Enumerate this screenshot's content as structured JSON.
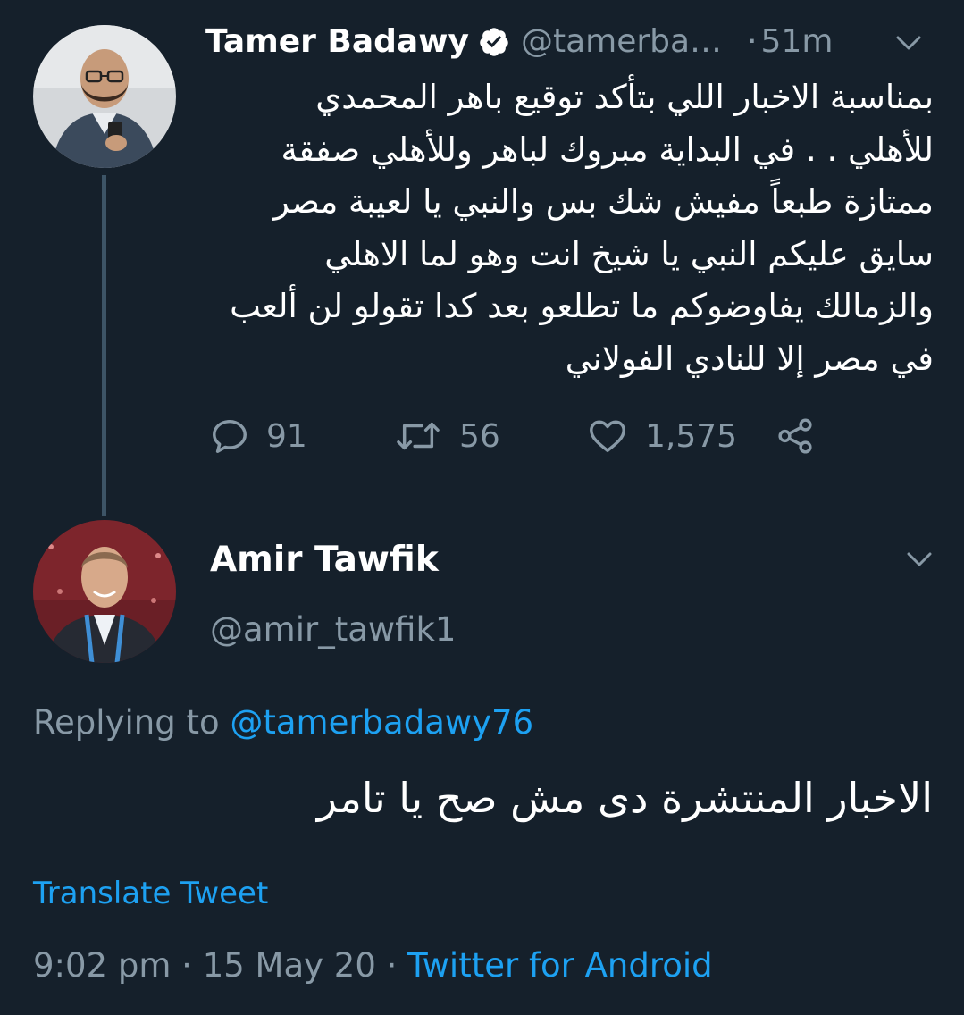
{
  "colors": {
    "background": "#15202b",
    "secondary_text": "#8899a6",
    "link": "#1da1f2",
    "thread_line": "#3d5466"
  },
  "tweet1": {
    "author_name": "Tamer Badawy",
    "verified_icon": "verified-badge-icon",
    "handle": "@tamerba…",
    "separator": "·",
    "time": "51m",
    "lines": [
      "بمناسبة الاخبار اللي بتأكد توقيع باهر المحمدي",
      "للأهلي . . في البداية مبروك لباهر وللأهلي صفقة",
      "ممتازة طبعاً مفيش شك بس والنبي يا لعيبة مصر",
      "سايق عليكم النبي يا شيخ انت وهو لما الاهلي",
      "والزمالك يفاوضوكم ما تطلعو بعد كدا تقولو لن ألعب",
      "في مصر إلا للنادي الفولاني"
    ],
    "actions": {
      "reply_icon": "reply-icon",
      "reply_count": "91",
      "retweet_icon": "retweet-icon",
      "retweet_count": "56",
      "like_icon": "heart-icon",
      "like_count": "1,575",
      "share_icon": "share-icon"
    }
  },
  "tweet2": {
    "author_name": "Amir Tawfik",
    "handle": "@amir_tawfik1",
    "replying_prefix": "Replying to ",
    "replying_to": "@tamerbadawy76",
    "text": "الاخبار المنتشرة دى مش صح يا تامر",
    "translate_label": "Translate Tweet",
    "time": "9:02 pm",
    "date": "15 May 20",
    "meta_separator": " · ",
    "source": "Twitter for Android"
  }
}
